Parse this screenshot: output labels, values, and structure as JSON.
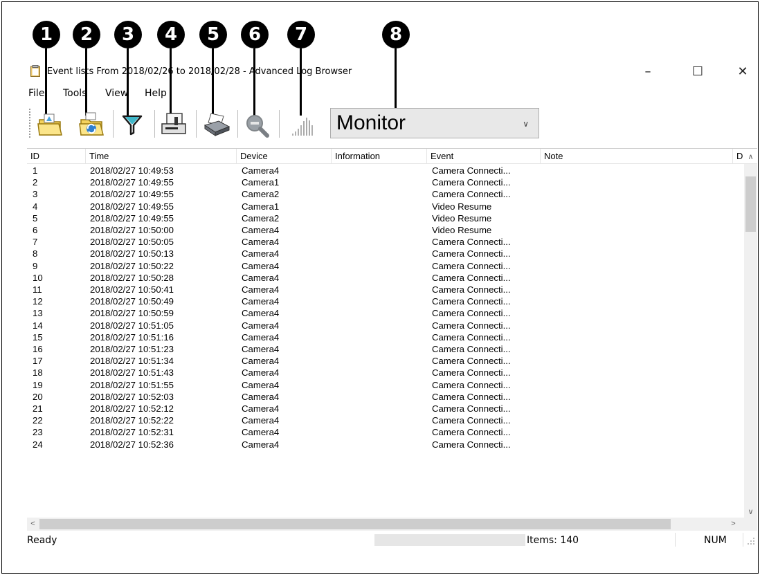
{
  "callouts": [
    "1",
    "2",
    "3",
    "4",
    "5",
    "6",
    "7",
    "8"
  ],
  "window": {
    "title": "Event lists From 2018/02/26 to 2018/02/28 - Advanced Log Browser",
    "minimize": "–",
    "maximize": "☐",
    "close": "✕"
  },
  "menu": [
    "File",
    "Tools",
    "View",
    "Help"
  ],
  "toolbar": {
    "buttons": [
      "open-log-icon",
      "refresh-log-icon",
      "filter-icon",
      "export-icon",
      "print-icon",
      "search-icon",
      "signal-icon"
    ],
    "monitor_select": "Monitor"
  },
  "table": {
    "columns": [
      "ID",
      "Time",
      "Device",
      "Information",
      "Event",
      "Note",
      "D"
    ],
    "rows": [
      [
        "1",
        "2018/02/27 10:49:53",
        "Camera4",
        "",
        "Camera Connecti...",
        ""
      ],
      [
        "2",
        "2018/02/27 10:49:55",
        "Camera1",
        "",
        "Camera Connecti...",
        ""
      ],
      [
        "3",
        "2018/02/27 10:49:55",
        "Camera2",
        "",
        "Camera Connecti...",
        ""
      ],
      [
        "4",
        "2018/02/27 10:49:55",
        "Camera1",
        "",
        "Video Resume",
        ""
      ],
      [
        "5",
        "2018/02/27 10:49:55",
        "Camera2",
        "",
        "Video Resume",
        ""
      ],
      [
        "6",
        "2018/02/27 10:50:00",
        "Camera4",
        "",
        "Video Resume",
        ""
      ],
      [
        "7",
        "2018/02/27 10:50:05",
        "Camera4",
        "",
        "Camera Connecti...",
        ""
      ],
      [
        "8",
        "2018/02/27 10:50:13",
        "Camera4",
        "",
        "Camera Connecti...",
        ""
      ],
      [
        "9",
        "2018/02/27 10:50:22",
        "Camera4",
        "",
        "Camera Connecti...",
        ""
      ],
      [
        "10",
        "2018/02/27 10:50:28",
        "Camera4",
        "",
        "Camera Connecti...",
        ""
      ],
      [
        "11",
        "2018/02/27 10:50:41",
        "Camera4",
        "",
        "Camera Connecti...",
        ""
      ],
      [
        "12",
        "2018/02/27 10:50:49",
        "Camera4",
        "",
        "Camera Connecti...",
        ""
      ],
      [
        "13",
        "2018/02/27 10:50:59",
        "Camera4",
        "",
        "Camera Connecti...",
        ""
      ],
      [
        "14",
        "2018/02/27 10:51:05",
        "Camera4",
        "",
        "Camera Connecti...",
        ""
      ],
      [
        "15",
        "2018/02/27 10:51:16",
        "Camera4",
        "",
        "Camera Connecti...",
        ""
      ],
      [
        "16",
        "2018/02/27 10:51:23",
        "Camera4",
        "",
        "Camera Connecti...",
        ""
      ],
      [
        "17",
        "2018/02/27 10:51:34",
        "Camera4",
        "",
        "Camera Connecti...",
        ""
      ],
      [
        "18",
        "2018/02/27 10:51:43",
        "Camera4",
        "",
        "Camera Connecti...",
        ""
      ],
      [
        "19",
        "2018/02/27 10:51:55",
        "Camera4",
        "",
        "Camera Connecti...",
        ""
      ],
      [
        "20",
        "2018/02/27 10:52:03",
        "Camera4",
        "",
        "Camera Connecti...",
        ""
      ],
      [
        "21",
        "2018/02/27 10:52:12",
        "Camera4",
        "",
        "Camera Connecti...",
        ""
      ],
      [
        "22",
        "2018/02/27 10:52:22",
        "Camera4",
        "",
        "Camera Connecti...",
        ""
      ],
      [
        "23",
        "2018/02/27 10:52:31",
        "Camera4",
        "",
        "Camera Connecti...",
        ""
      ],
      [
        "24",
        "2018/02/27 10:52:36",
        "Camera4",
        "",
        "Camera Connecti...",
        ""
      ]
    ]
  },
  "status": {
    "ready": "Ready",
    "items": "Items: 140",
    "num": "NUM"
  },
  "colors": {
    "callout": "#000000",
    "scrollbar": "#f0f0f0",
    "thumb": "#cdcdcd"
  }
}
